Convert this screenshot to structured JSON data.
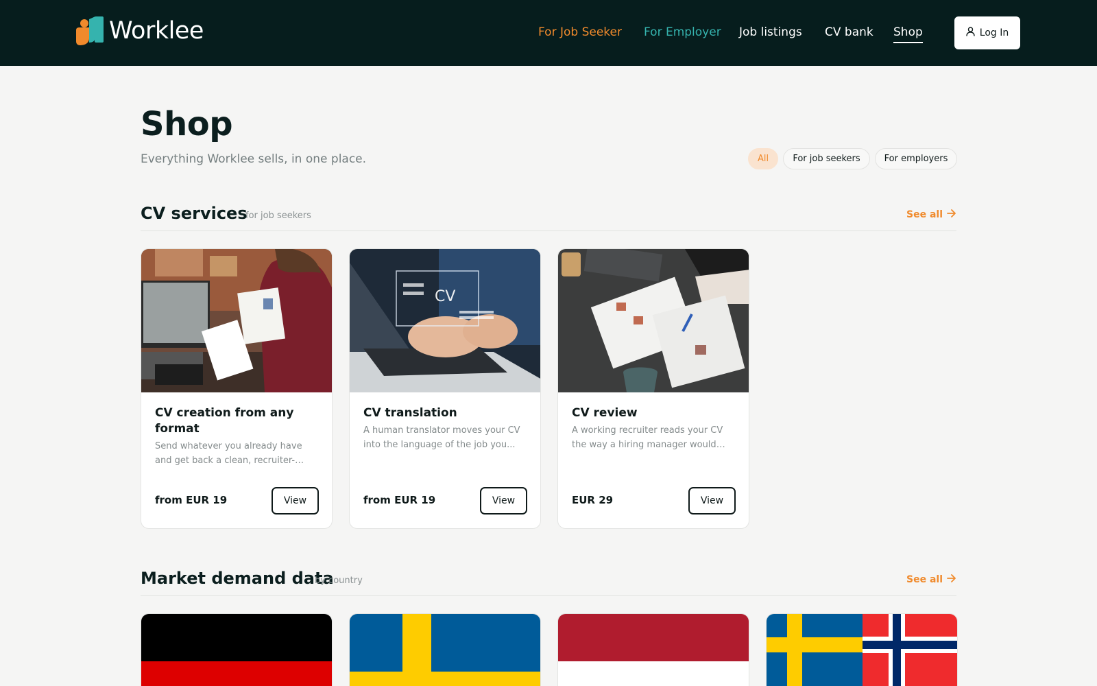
{
  "header": {
    "brand": "Worklee",
    "nav": [
      {
        "label": "For Job Seeker"
      },
      {
        "label": "For Employer"
      },
      {
        "label": "Job listings"
      },
      {
        "label": "CV bank"
      },
      {
        "label": "Shop"
      }
    ],
    "login_label": "Log In"
  },
  "page": {
    "title": "Shop",
    "subtitle": "Everything Worklee sells, in one place."
  },
  "filters": {
    "active": "All",
    "options": [
      "All",
      "For job seekers",
      "For employers"
    ]
  },
  "sections": [
    {
      "title": "CV services",
      "subtitle": "for job seekers",
      "see_all": "See all"
    },
    {
      "title": "Market demand data",
      "subtitle": "by country",
      "see_all": "See all"
    }
  ],
  "products": [
    {
      "title": "CV creation from any format",
      "description": "Send whatever you already have and get back a clean, recruiter-ready CV...",
      "price": "from EUR 19",
      "button": "View"
    },
    {
      "title": "CV translation",
      "description": "A human translator moves your CV into the language of the job you...",
      "price": "from EUR 19",
      "button": "View"
    },
    {
      "title": "CV review",
      "description": "A working recruiter reads your CV the way a hiring manager would and...",
      "price": "EUR 29",
      "button": "View"
    }
  ],
  "country_flags": [
    "germany-flag",
    "sweden-flag",
    "poland-flag",
    "sweden-norway-flag"
  ],
  "colors": {
    "header_bg": "#061d1d",
    "accent_orange": "#f08a2c",
    "accent_teal": "#35b3ae",
    "page_bg": "#f5f5f4"
  }
}
